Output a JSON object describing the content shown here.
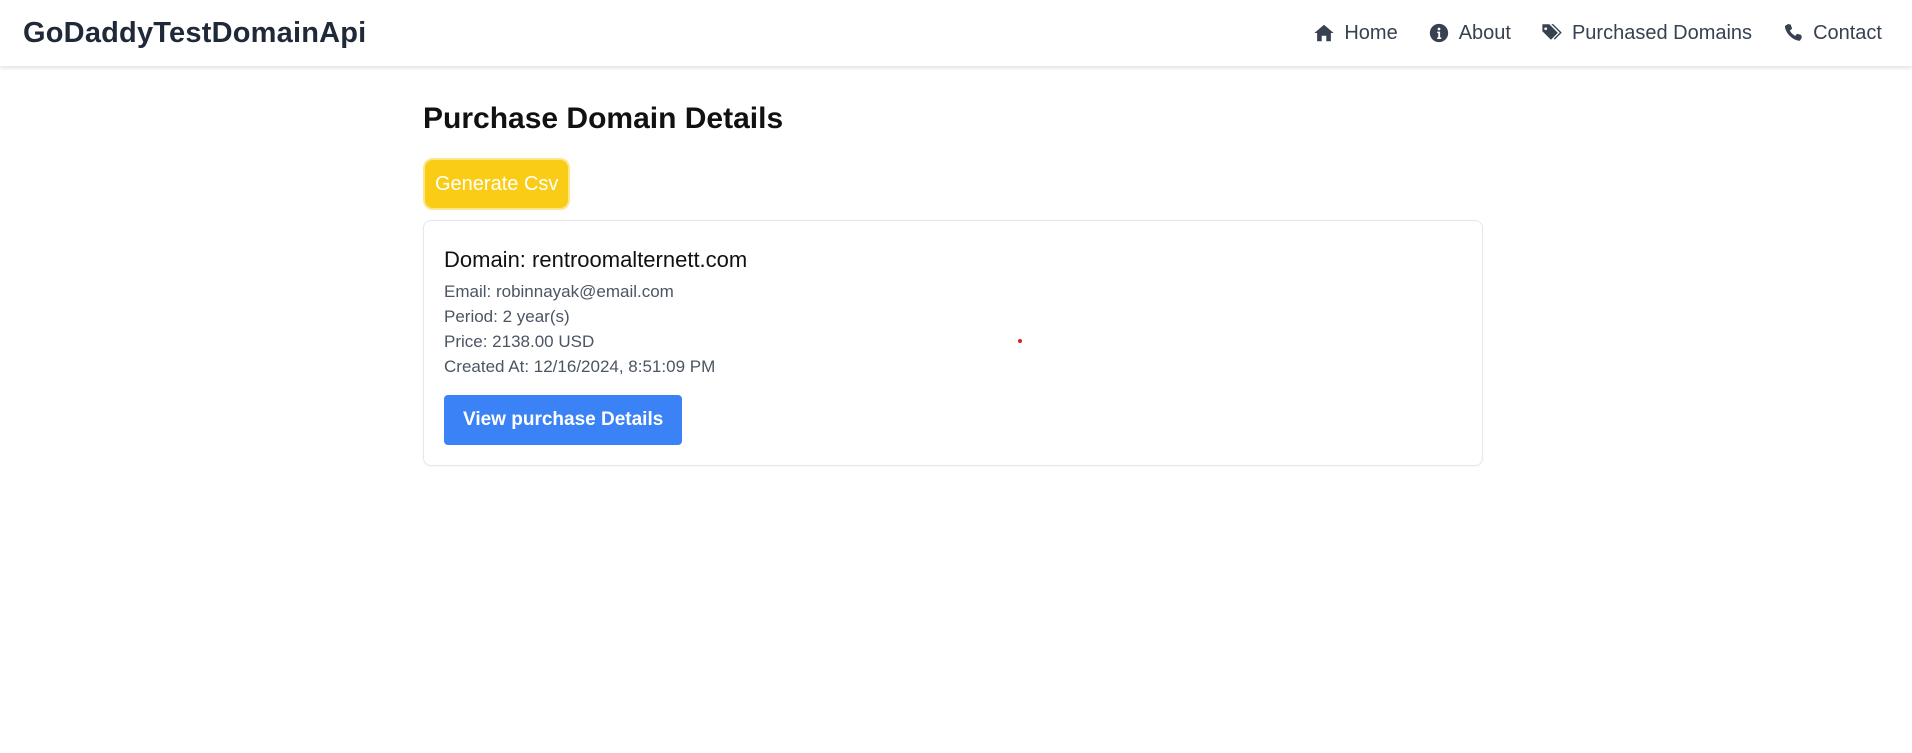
{
  "navbar": {
    "brand": "GoDaddyTestDomainApi",
    "links": [
      {
        "label": "Home",
        "icon": "home-icon"
      },
      {
        "label": "About",
        "icon": "info-circle-icon"
      },
      {
        "label": "Purchased Domains",
        "icon": "tags-icon"
      },
      {
        "label": "Contact",
        "icon": "phone-icon"
      }
    ]
  },
  "main": {
    "title": "Purchase Domain Details",
    "csv_button_label": "Generate Csv",
    "purchases": [
      {
        "domain": "Domain: rentroomalternett.com",
        "email": "Email: robinnayak@email.com",
        "period": "Period: 2 year(s)",
        "price": "Price: 2138.00 USD",
        "created_at": "Created At: 12/16/2024, 8:51:09 PM",
        "button_label": "View purchase Details"
      }
    ]
  },
  "colors": {
    "csv_button": "#facc15",
    "view_button": "#3b82f6",
    "text_dark": "#1f2937",
    "text_muted": "#4b5563"
  }
}
